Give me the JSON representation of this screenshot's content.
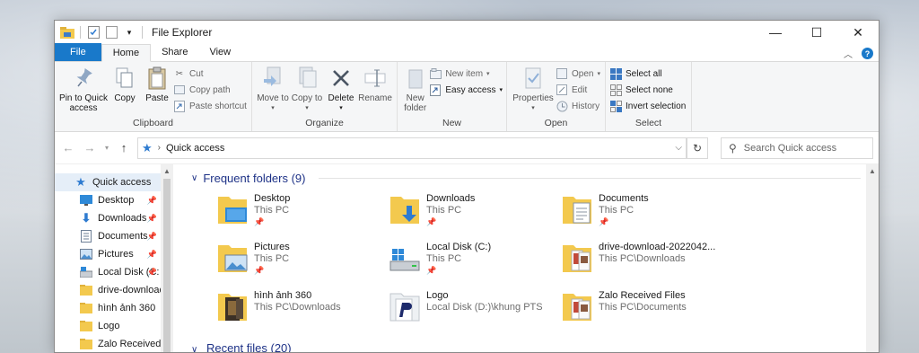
{
  "window": {
    "title": "File Explorer",
    "controls": {
      "minimize": "—",
      "maximize": "☐",
      "close": "✕"
    }
  },
  "tabs": {
    "file": "File",
    "home": "Home",
    "share": "Share",
    "view": "View"
  },
  "ribbon": {
    "clipboard": {
      "label": "Clipboard",
      "pin_to_quick_access": "Pin to Quick access",
      "copy": "Copy",
      "paste": "Paste",
      "cut": "Cut",
      "copy_path": "Copy path",
      "paste_shortcut": "Paste shortcut"
    },
    "organize": {
      "label": "Organize",
      "move_to": "Move to",
      "copy_to": "Copy to",
      "delete": "Delete",
      "rename": "Rename"
    },
    "new": {
      "label": "New",
      "new_folder": "New folder",
      "new_item": "New item",
      "easy_access": "Easy access"
    },
    "open": {
      "label": "Open",
      "properties": "Properties",
      "open": "Open",
      "edit": "Edit",
      "history": "History"
    },
    "select": {
      "label": "Select",
      "select_all": "Select all",
      "select_none": "Select none",
      "invert_selection": "Invert selection"
    }
  },
  "address": {
    "crumb": "Quick access",
    "search_placeholder": "Search Quick access"
  },
  "navpane": {
    "items": [
      {
        "label": "Quick access",
        "icon": "star-icon"
      },
      {
        "label": "Desktop",
        "icon": "desktop-icon",
        "pinned": true
      },
      {
        "label": "Downloads",
        "icon": "download-icon",
        "pinned": true
      },
      {
        "label": "Documents",
        "icon": "documents-icon",
        "pinned": true
      },
      {
        "label": "Pictures",
        "icon": "pictures-icon",
        "pinned": true
      },
      {
        "label": "Local Disk (C:",
        "icon": "drive-icon",
        "pinned": true
      },
      {
        "label": "drive-download-",
        "icon": "folder-icon"
      },
      {
        "label": "hình ảnh 360",
        "icon": "folder-icon"
      },
      {
        "label": "Logo",
        "icon": "folder-icon"
      },
      {
        "label": "Zalo Received Fi",
        "icon": "folder-icon"
      }
    ]
  },
  "frequent": {
    "header": "Frequent folders (9)",
    "folders": [
      {
        "name": "Desktop",
        "location": "This PC",
        "pinned": true
      },
      {
        "name": "Downloads",
        "location": "This PC",
        "pinned": true
      },
      {
        "name": "Documents",
        "location": "This PC",
        "pinned": true
      },
      {
        "name": "Pictures",
        "location": "This PC",
        "pinned": true
      },
      {
        "name": "Local Disk (C:)",
        "location": "This PC",
        "pinned": true
      },
      {
        "name": "drive-download-2022042...",
        "location": "This PC\\Downloads",
        "pinned": false
      },
      {
        "name": "hình ảnh 360",
        "location": "This PC\\Downloads",
        "pinned": false
      },
      {
        "name": "Logo",
        "location": "Local Disk (D:)\\khung PTS",
        "pinned": false
      },
      {
        "name": "Zalo Received Files",
        "location": "This PC\\Documents",
        "pinned": false
      }
    ]
  },
  "recent": {
    "header": "Recent files (20)"
  },
  "colors": {
    "accent": "#1979ca",
    "section_header": "#1e3287",
    "folder": "#f3c94e",
    "selection": "#e5eef8"
  }
}
